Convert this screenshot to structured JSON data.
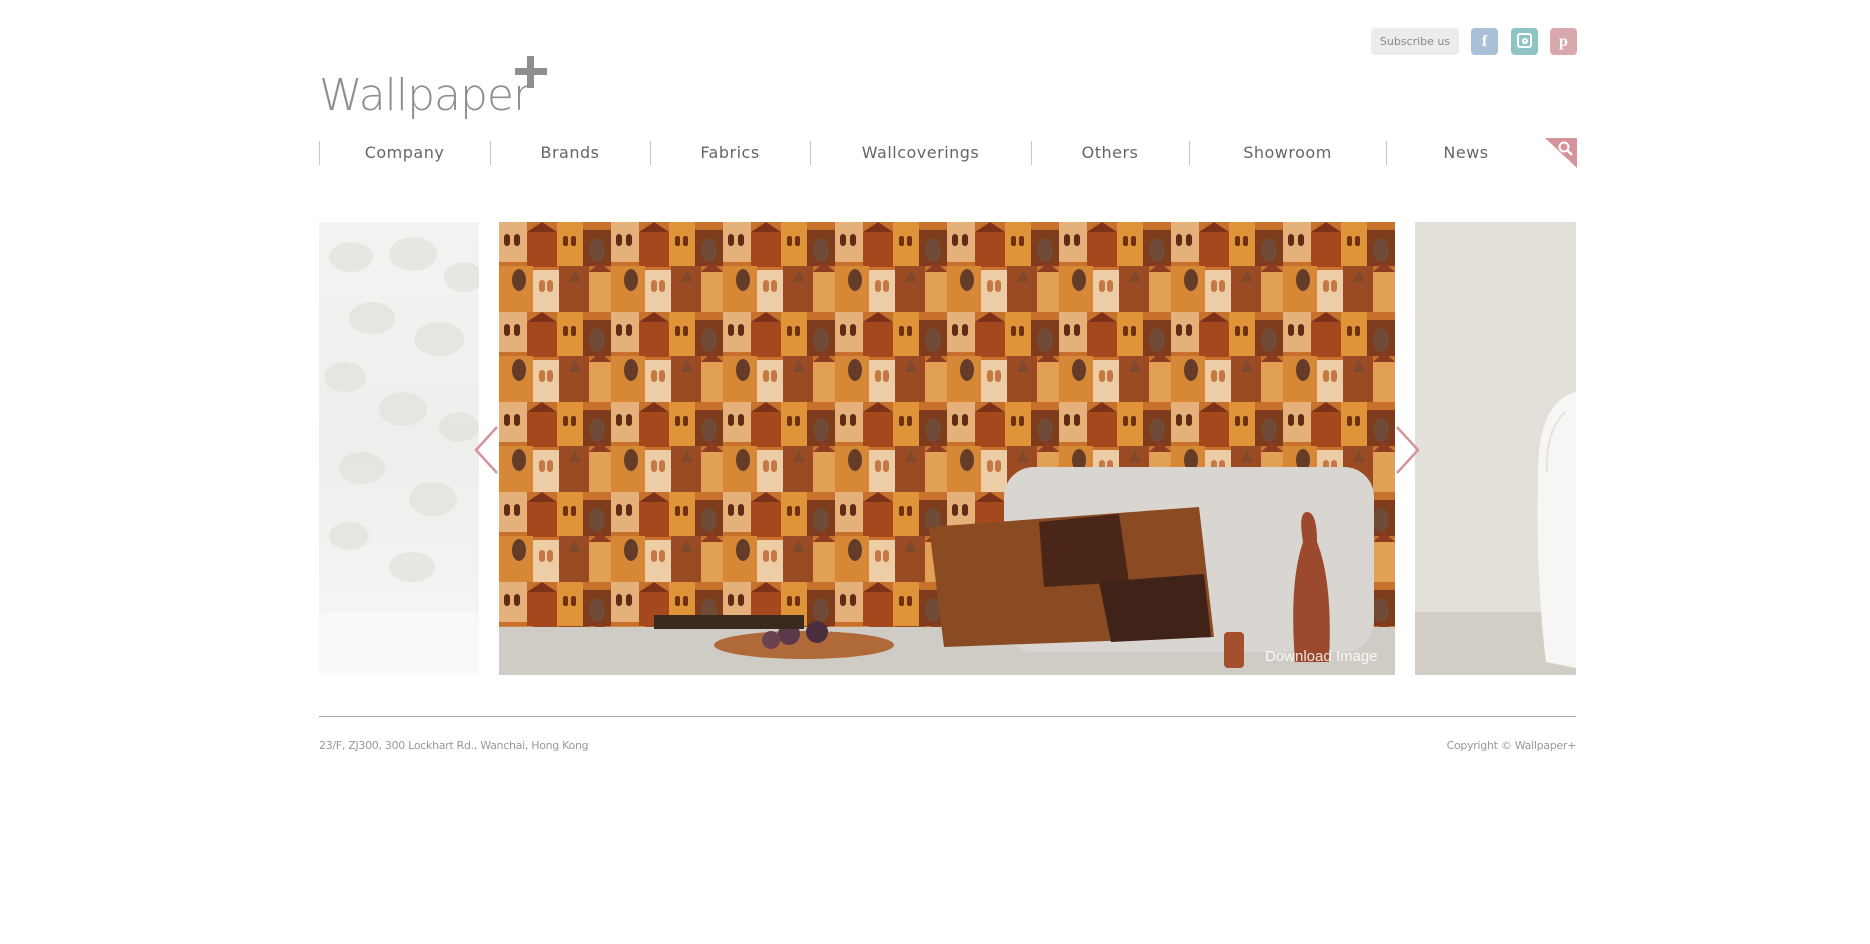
{
  "header": {
    "logo_text": "Wallpaper",
    "subscribe_label": "Subscribe us",
    "social": {
      "facebook_glyph": "f",
      "pinterest_glyph": "p",
      "facebook_icon": "facebook-icon",
      "instagram_icon": "instagram-icon",
      "pinterest_icon": "pinterest-icon",
      "facebook_color": "#a8c0d8",
      "instagram_color": "#8fc4c4",
      "pinterest_color": "#d8a8ac"
    }
  },
  "nav": {
    "items": [
      {
        "label": "Company"
      },
      {
        "label": "Brands"
      },
      {
        "label": "Fabrics"
      },
      {
        "label": "Wallcoverings"
      },
      {
        "label": "Others"
      },
      {
        "label": "Showroom"
      },
      {
        "label": "News"
      }
    ],
    "search_icon": "search-icon",
    "accent_color": "#d4949a"
  },
  "carousel": {
    "download_label": "Download Image",
    "prev_icon": "chevron-left-icon",
    "next_icon": "chevron-right-icon"
  },
  "footer": {
    "address": "23/F, ZJ300, 300 Lockhart Rd., Wanchai, Hong Kong",
    "copyright": "Copyright © Wallpaper+"
  }
}
